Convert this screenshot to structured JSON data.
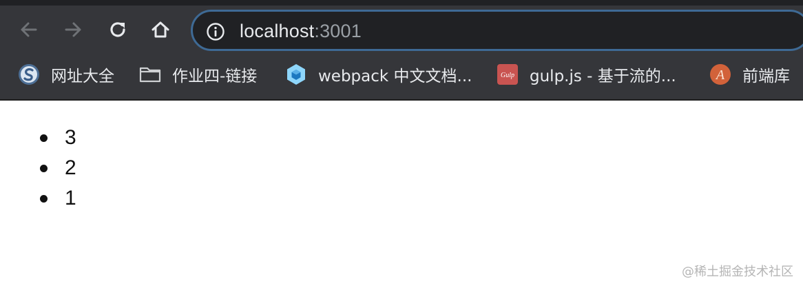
{
  "browser": {
    "address_bar": {
      "host": "localhost",
      "port": ":3001",
      "info_icon": "info-icon"
    },
    "nav_icons": [
      "back-arrow-icon",
      "forward-arrow-icon",
      "reload-icon",
      "home-icon"
    ],
    "bookmarks": [
      {
        "label": "网址大全",
        "icon": "globe-s-icon"
      },
      {
        "label": "作业四-链接",
        "icon": "folder-icon"
      },
      {
        "label": "webpack 中文文档...",
        "icon": "webpack-cube-icon"
      },
      {
        "label": "gulp.js - 基于流的...",
        "icon": "gulp-logo-icon"
      },
      {
        "label": "前端库",
        "icon": "letter-a-badge-icon"
      }
    ]
  },
  "page": {
    "list_items": [
      "3",
      "2",
      "1"
    ]
  },
  "watermark": "@稀土掘金技术社区",
  "colors": {
    "toolbar_bg": "#35363a",
    "omnibox_bg": "#202124",
    "omnibox_border": "#3e6a95",
    "text_light": "#e8eaed",
    "port_gray": "#9aa0a6"
  }
}
